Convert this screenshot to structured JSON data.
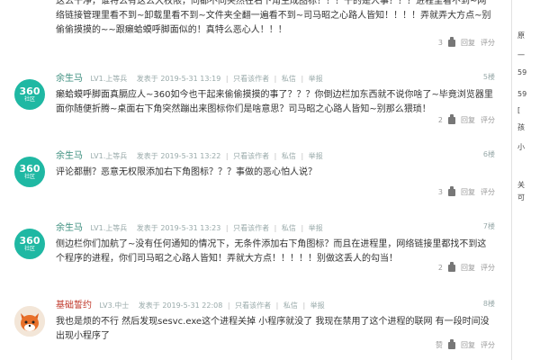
{
  "posts": [
    {
      "content": "这么干净，谁特么有这么大权限，同都不同突然在右下角生成图标！！！干的是人事？？？进程里看不到~网络链接管理里看不到~卸载里看不到~文件夹全翻一遍看不到~司马昭之心路人皆知！！！！弄就弄大方点~别偷偷摸摸的~~跟癞蛤蟆呼脚面似的！真特么恶心人！！！",
      "likes": "3",
      "reply_label": "回复",
      "rate_label": "评分"
    },
    {
      "avatar_text": "360",
      "avatar_sub": "社区",
      "username": "余生马",
      "level": "LV1.上等兵",
      "posted": "发表于 2019-5-31 13:19",
      "view_author": "只看该作者",
      "message": "私信",
      "report": "举报",
      "floor": "5楼",
      "content": "癞蛤蟆呼脚面真膈应人~360如今也干起来偷偷摸摸的事了？？？你倒边栏加东西就不说你啥了~毕竟浏览器里面你随便折腾~桌面右下角突然蹦出来图标你们是啥意思？司马昭之心路人皆知~别那么猥琐！",
      "likes": "2",
      "reply_label": "回复",
      "rate_label": "评分"
    },
    {
      "avatar_text": "360",
      "avatar_sub": "社区",
      "username": "余生马",
      "level": "LV1.上等兵",
      "posted": "发表于 2019-5-31 13:22",
      "view_author": "只看该作者",
      "message": "私信",
      "report": "举报",
      "floor": "6楼",
      "content": "评论都删？恶意无权限添加右下角图标？？？事做的恶心怕人说？",
      "likes": "3",
      "reply_label": "回复",
      "rate_label": "评分"
    },
    {
      "avatar_text": "360",
      "avatar_sub": "社区",
      "username": "余生马",
      "level": "LV1.上等兵",
      "posted": "发表于 2019-5-31 13:23",
      "view_author": "只看该作者",
      "message": "私信",
      "report": "举报",
      "floor": "7楼",
      "content": "侧边栏你们加航了~没有任何通知的情况下，无条件添加右下角图标？而且在进程里，网络链接里都找不到这个程序的进程，你们司马昭之心路人皆知！弄就大方点！！！！！别做这丢人的勾当！",
      "likes": "2",
      "reply_label": "回复",
      "rate_label": "评分"
    },
    {
      "username": "基础誓约",
      "level": "LV3.中士",
      "posted": "发表于 2019-5-31 22:08",
      "view_author": "只看该作者",
      "message": "私信",
      "report": "举报",
      "floor": "8楼",
      "content": "我也是烦的不行 然后发现sesvc.exe这个进程关掉 小程序就没了 我现在禁用了这个进程的联网 有一段时间没出现小程序了",
      "likes": "赞",
      "reply_label": "回复",
      "rate_label": "评分"
    }
  ],
  "sidebar": [
    "原",
    "一",
    "59",
    "59",
    "[",
    "孩",
    "小",
    "关",
    "可"
  ]
}
